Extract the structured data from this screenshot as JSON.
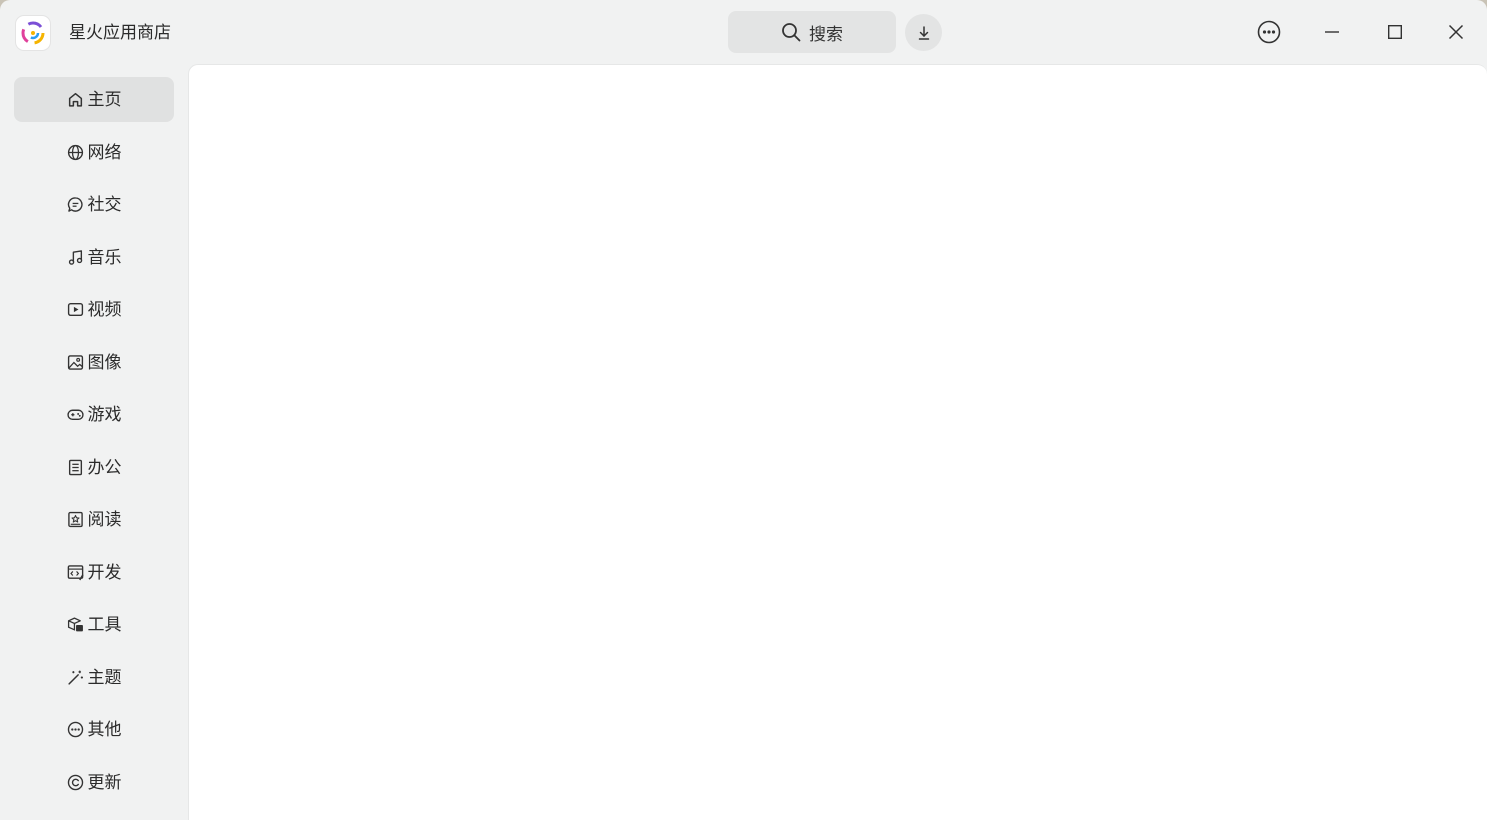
{
  "app": {
    "title": "星火应用商店",
    "logo_icon": "spark-store-logo"
  },
  "toolbar": {
    "search_label": "搜索",
    "search_icon": "search-icon",
    "download_icon": "download-icon",
    "menu_icon": "more-icon"
  },
  "sidebar": {
    "items": [
      {
        "label": "主页",
        "icon": "home-icon",
        "active": true
      },
      {
        "label": "网络",
        "icon": "globe-icon"
      },
      {
        "label": "社交",
        "icon": "chat-icon"
      },
      {
        "label": "音乐",
        "icon": "music-icon"
      },
      {
        "label": "视频",
        "icon": "video-icon"
      },
      {
        "label": "图像",
        "icon": "image-icon"
      },
      {
        "label": "游戏",
        "icon": "gamepad-icon"
      },
      {
        "label": "办公",
        "icon": "document-icon"
      },
      {
        "label": "阅读",
        "icon": "book-icon"
      },
      {
        "label": "开发",
        "icon": "code-icon"
      },
      {
        "label": "工具",
        "icon": "toolbox-icon"
      },
      {
        "label": "主题",
        "icon": "wand-icon"
      },
      {
        "label": "其他",
        "icon": "more-circle-icon"
      },
      {
        "label": "更新",
        "icon": "update-icon"
      }
    ]
  },
  "colors": {
    "window_bg": "#f1f2f2",
    "content_bg": "#ffffff",
    "active_item_bg": "#e0e1e1",
    "button_bg": "#e3e4e4"
  }
}
